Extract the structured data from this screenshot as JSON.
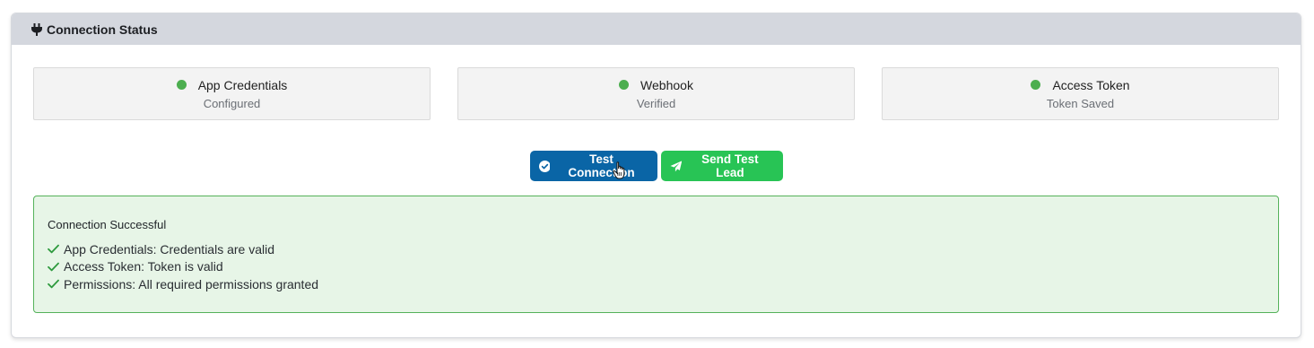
{
  "header": {
    "title": "Connection Status",
    "icon": "plug-icon"
  },
  "status_items": [
    {
      "label": "App Credentials",
      "status": "Configured",
      "dot_color": "#4cae4f"
    },
    {
      "label": "Webhook",
      "status": "Verified",
      "dot_color": "#4cae4f"
    },
    {
      "label": "Access Token",
      "status": "Token Saved",
      "dot_color": "#4cae4f"
    }
  ],
  "buttons": {
    "test_connection": {
      "label": "Test Connection",
      "icon": "check-circle-icon",
      "color": "#0a65a6"
    },
    "send_test_lead": {
      "label": "Send Test Lead",
      "icon": "paper-plane-icon",
      "color": "#28c455"
    }
  },
  "result": {
    "title": "Connection Successful",
    "items": [
      "App Credentials: Credentials are valid",
      "Access Token: Token is valid",
      "Permissions: All required permissions granted"
    ],
    "check_color": "#2e9a3e",
    "background": "#e7f5e7"
  }
}
